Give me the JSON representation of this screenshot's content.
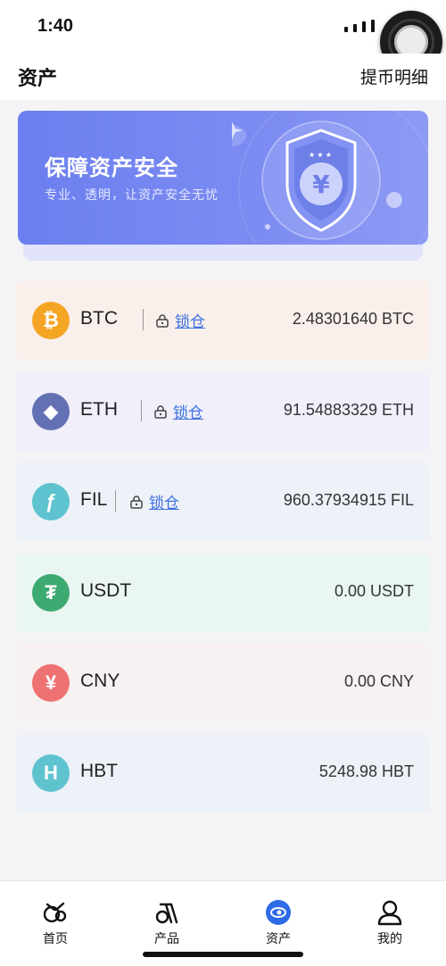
{
  "status": {
    "time": "1:40"
  },
  "header": {
    "title": "资产",
    "details": "提币明细"
  },
  "banner": {
    "title": "保障资产安全",
    "subtitle": "专业、透明，让资产安全无忧"
  },
  "assets": [
    {
      "symbol": "BTC",
      "icon": "bitcoin-icon",
      "glyph": "₿",
      "color": "#f5a524",
      "bg": "#f9f0ec",
      "locked": true,
      "lock_label": "锁仓",
      "balance": "2.48301640 BTC"
    },
    {
      "symbol": "ETH",
      "icon": "ethereum-icon",
      "glyph": "◆",
      "color": "#6470b4",
      "bg": "#f0effa",
      "locked": true,
      "lock_label": "锁仓",
      "balance": "91.54883329 ETH"
    },
    {
      "symbol": "FIL",
      "icon": "filecoin-icon",
      "glyph": "ƒ",
      "color": "#5fc3cf",
      "bg": "#edf1f8",
      "locked": true,
      "lock_label": "锁仓",
      "balance": "960.37934915 FIL"
    },
    {
      "symbol": "USDT",
      "icon": "tether-icon",
      "glyph": "₮",
      "color": "#3daa72",
      "bg": "#eaf6f1",
      "locked": false,
      "balance": "0.00 USDT"
    },
    {
      "symbol": "CNY",
      "icon": "yuan-icon",
      "glyph": "¥",
      "color": "#ee7272",
      "bg": "#f8f1f1",
      "locked": false,
      "balance": "0.00 CNY"
    },
    {
      "symbol": "HBT",
      "icon": "hbt-icon",
      "glyph": "H",
      "color": "#5fc3cf",
      "bg": "#edf1f8",
      "locked": false,
      "balance": "5248.98 HBT"
    }
  ],
  "tabs": [
    {
      "label": "首页",
      "icon": "home-icon"
    },
    {
      "label": "产品",
      "icon": "product-icon"
    },
    {
      "label": "资产",
      "icon": "assets-icon",
      "active": true
    },
    {
      "label": "我的",
      "icon": "profile-icon"
    }
  ],
  "colors": {
    "accent": "#3b6fe0",
    "banner": "#7283f1"
  }
}
